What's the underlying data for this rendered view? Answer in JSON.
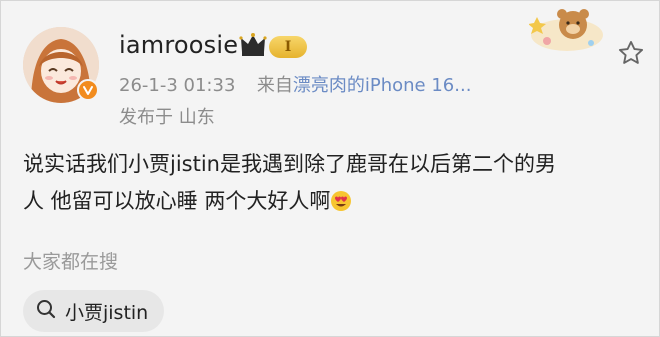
{
  "post": {
    "username": "iamroosie",
    "level_badge": "I",
    "timestamp": "26-1-3 01:33",
    "source_prefix": "来自",
    "source_device": "漂亮肉的iPhone 16...",
    "location": "发布于 山东",
    "content_line1": "说实话我们小贾jistin是我遇到除了鹿哥在以后第二个的男",
    "content_line2": "人 他留可以放心睡 两个大好人啊"
  },
  "trending": {
    "label": "大家都在搜",
    "chip_text": "小贾jistin"
  },
  "icons": {
    "verified": "v-badge-icon",
    "crown": "crown-icon",
    "follow": "star-icon",
    "search": "search-icon",
    "emoji": "heart-eyes-emoji-icon"
  },
  "colors": {
    "verified_badge": "#f28c1e",
    "source_link": "#6b8bc4",
    "level_badge": "#e6b32e",
    "meta_text": "#8c8c8c"
  }
}
